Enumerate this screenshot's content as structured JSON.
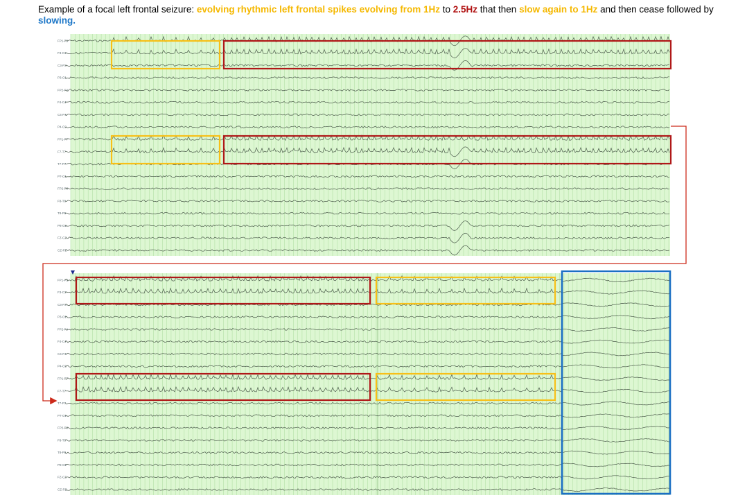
{
  "caption": {
    "parts": [
      {
        "text": "Example of a focal left frontal seizure: ",
        "style": "plain"
      },
      {
        "text": "evolving rhythmic left frontal spikes evolving from 1Hz",
        "style": "yellow"
      },
      {
        "text": " to ",
        "style": "plain"
      },
      {
        "text": "2.5Hz",
        "style": "red"
      },
      {
        "text": " that then ",
        "style": "plain"
      },
      {
        "text": "slow again to 1Hz",
        "style": "yellow"
      },
      {
        "text": " and then cease followed by ",
        "style": "plain"
      },
      {
        "text": "slowing.",
        "style": "blue"
      }
    ]
  },
  "colors": {
    "grid_background": "#ddf7d2",
    "grid_line": "#b4e0a6",
    "trace": "#4a5a4a",
    "yellow_box": "#f7c018",
    "red_box": "#b01818",
    "blue_box": "#1b6fc4",
    "connector": "#cc2a1a",
    "marker": "#1a2a8a"
  },
  "montage_channels": [
    "FP1-F3",
    "F3-C3",
    "C3-P3",
    "P3-O1",
    "FP2-F4",
    "F4-C4",
    "C4-P4",
    "P4-O2",
    "FP1-F7",
    "F7-T7",
    "T7-P7",
    "P7-O1",
    "FP2-F8",
    "F8-T8",
    "T8-P8",
    "P8-O2",
    "FZ-CZ",
    "CZ-PZ"
  ],
  "panels": [
    {
      "name": "eeg-panel-top",
      "annotations": [
        {
          "type": "yellow",
          "channels": "FP1-F3, F3-C3"
        },
        {
          "type": "red",
          "channels": "FP1-F3, F3-C3"
        },
        {
          "type": "yellow",
          "channels": "FP1-F7, F7-T7"
        },
        {
          "type": "red",
          "channels": "FP1-F7, F7-T7"
        }
      ]
    },
    {
      "name": "eeg-panel-bottom",
      "annotations": [
        {
          "type": "red",
          "channels": "FP1-F3, F3-C3"
        },
        {
          "type": "yellow",
          "channels": "FP1-F3, F3-C3"
        },
        {
          "type": "red",
          "channels": "FP1-F7, F7-T7"
        },
        {
          "type": "yellow",
          "channels": "FP1-F7, F7-T7"
        },
        {
          "type": "blue",
          "channels": "all"
        }
      ]
    }
  ]
}
